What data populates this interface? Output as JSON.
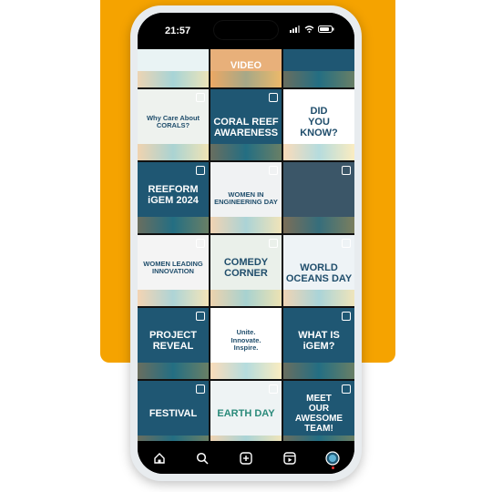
{
  "status_bar": {
    "time": "21:57"
  },
  "tiles": [
    {
      "name": "tile-row0-a",
      "bg": "#e9f3f4",
      "text": "",
      "color": "#1f4d6b"
    },
    {
      "name": "tile-row0-b",
      "bg": "#e8b07a",
      "text": "VIDEO",
      "color": "#ffffff"
    },
    {
      "name": "tile-row0-c",
      "bg": "#1f5773",
      "text": "",
      "color": "#ffffff"
    },
    {
      "name": "tile-why-care-corals",
      "bg": "#eef2ee",
      "text": "Why Care About\nCORALS?",
      "color": "#1f4d6b"
    },
    {
      "name": "tile-coral-reef-awareness",
      "bg": "#1f5773",
      "text": "CORAL REEF AWARENESS",
      "color": "#ffffff"
    },
    {
      "name": "tile-did-you-know",
      "bg": "#ffffff",
      "text": "DID\nYOU\nKNOW?",
      "color": "#1f4d6b"
    },
    {
      "name": "tile-reeform-igem-2024",
      "bg": "#1f5773",
      "text": "REEFORM\niGEM 2024",
      "color": "#ffffff"
    },
    {
      "name": "tile-women-in-engineering-day",
      "bg": "#f0f2f3",
      "text": "WOMEN IN ENGINEERING DAY",
      "color": "#1f4d6b"
    },
    {
      "name": "tile-lab-photo",
      "bg": "#3b5668",
      "text": "",
      "color": "#ffffff"
    },
    {
      "name": "tile-women-leading-innovation",
      "bg": "#f4f4f4",
      "text": "WOMEN LEADING\nINNOVATION",
      "color": "#1f4d6b"
    },
    {
      "name": "tile-comedy-corner",
      "bg": "#eaf0ea",
      "text": "COMEDY\nCORNER",
      "color": "#1f4d6b"
    },
    {
      "name": "tile-world-oceans-day",
      "bg": "#eef3f6",
      "text": "WORLD OCEANS DAY",
      "color": "#1f4d6b"
    },
    {
      "name": "tile-project-reveal",
      "bg": "#1f5773",
      "text": "PROJECT\nREVEAL",
      "color": "#ffffff"
    },
    {
      "name": "tile-unite-innovate-inspire",
      "bg": "#ffffff",
      "text": "Unite.\nInnovate.\nInspire.",
      "color": "#1f4d6b"
    },
    {
      "name": "tile-what-is-igem",
      "bg": "#1f5773",
      "text": "WHAT IS\niGEM?",
      "color": "#ffffff"
    },
    {
      "name": "tile-festival",
      "bg": "#1f5773",
      "text": "FESTIVAL",
      "color": "#ffffff"
    },
    {
      "name": "tile-earth-day",
      "bg": "#eef3f4",
      "text": "EARTH DAY",
      "color": "#2a8a7a"
    },
    {
      "name": "tile-meet-our-awesome-team",
      "bg": "#1f5773",
      "text": "MEET\nOUR\nAWESOME\nTEAM!",
      "color": "#ffffff"
    }
  ],
  "nav": [
    "home-icon",
    "search-icon",
    "create-icon",
    "reels-icon",
    "profile-icon"
  ]
}
